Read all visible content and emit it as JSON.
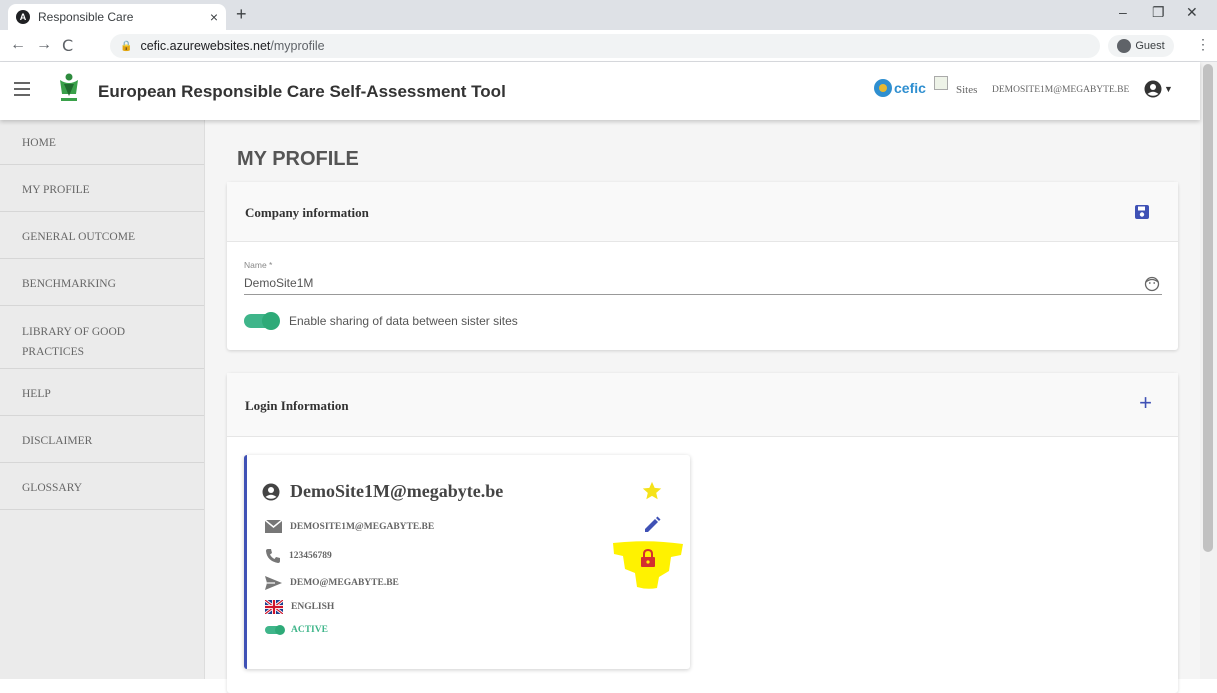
{
  "browser": {
    "tab_title": "Responsible Care",
    "tab_close": "×",
    "new_tab": "+",
    "url_domain": "cefic.azurewebsites.net",
    "url_path": "/myprofile",
    "profile_label": "Guest",
    "win_min": "–",
    "win_restore": "❐",
    "win_close": "✕",
    "back": "←",
    "forward": "→",
    "reload": "C",
    "kebab": "⋮"
  },
  "header": {
    "title": "European Responsible Care Self-Assessment Tool",
    "cefic_text": "cefic",
    "sites_label": "Sites",
    "user_email": "DEMOSITE1M@MEGABYTE.BE"
  },
  "sidebar": {
    "items": [
      {
        "label": "HOME"
      },
      {
        "label": "MY PROFILE"
      },
      {
        "label": "GENERAL OUTCOME"
      },
      {
        "label": "BENCHMARKING"
      },
      {
        "label": "LIBRARY OF GOOD PRACTICES"
      },
      {
        "label": "HELP"
      },
      {
        "label": "DISCLAIMER"
      },
      {
        "label": "GLOSSARY"
      }
    ]
  },
  "main": {
    "page_title": "MY PROFILE",
    "company": {
      "heading": "Company information",
      "name_label": "Name *",
      "name_value": "DemoSite1M",
      "sharing_label": "Enable sharing of data between sister sites",
      "sharing_enabled": true
    },
    "login": {
      "heading": "Login Information",
      "user": {
        "username": "DemoSite1M@megabyte.be",
        "email": "DEMOSITE1M@MEGABYTE.BE",
        "phone": "123456789",
        "send_to": "DEMO@MEGABYTE.BE",
        "language": "ENGLISH",
        "status": "ACTIVE"
      }
    }
  },
  "colors": {
    "accent": "#3f51b5",
    "toggle_green": "#3fb58a",
    "star": "#f5d90a",
    "lock": "#d32f2f",
    "highlight": "#fff200"
  }
}
